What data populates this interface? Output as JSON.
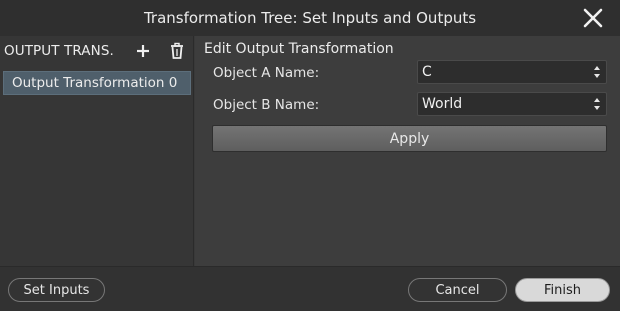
{
  "window": {
    "title": "Transformation Tree: Set Inputs and Outputs"
  },
  "sidebar": {
    "title": "OUTPUT TRANS.",
    "items": [
      {
        "label": "Output Transformation 0"
      }
    ]
  },
  "editor": {
    "section_title": "Edit Output Transformation",
    "object_a": {
      "label": "Object A Name:",
      "value": "C"
    },
    "object_b": {
      "label": "Object B Name:",
      "value": "World"
    },
    "apply_label": "Apply"
  },
  "footer": {
    "set_inputs_label": "Set Inputs",
    "cancel_label": "Cancel",
    "finish_label": "Finish"
  },
  "icons": {
    "close": "close-icon",
    "add": "plus-icon",
    "delete": "trash-icon",
    "select_arrows": "updown-arrows-icon"
  },
  "colors": {
    "selection": "#4f5f6b",
    "apply_button": "#6a6a6a",
    "finish_button": "#d9d9d9"
  }
}
